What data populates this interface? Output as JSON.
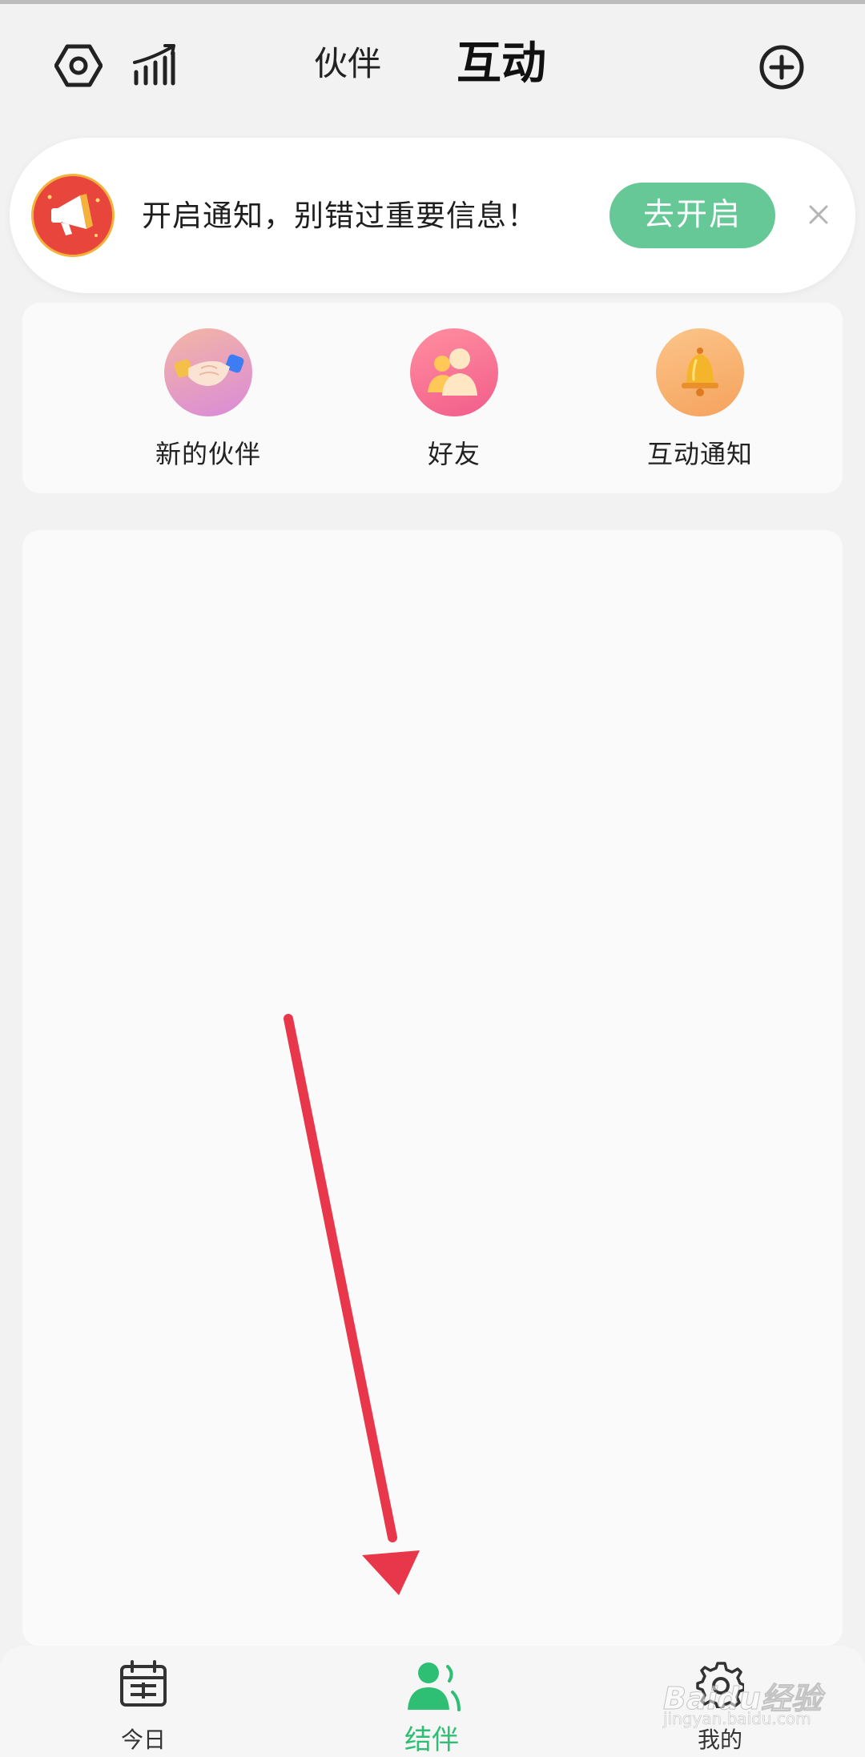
{
  "header": {
    "tabs": [
      {
        "label": "伙伴",
        "active": false
      },
      {
        "label": "互动",
        "active": true
      }
    ],
    "icons": [
      "hexagon-settings-icon",
      "stats-icon",
      "add-circle-icon"
    ]
  },
  "notice": {
    "text": "开启通知，别错过重要信息！",
    "button_label": "去开启",
    "icon": "megaphone-icon",
    "close_icon": "close-icon"
  },
  "quick_actions": [
    {
      "label": "新的伙伴",
      "icon": "handshake-icon"
    },
    {
      "label": "好友",
      "icon": "friends-icon"
    },
    {
      "label": "互动通知",
      "icon": "bell-icon"
    }
  ],
  "bottom_nav": {
    "items": [
      {
        "label": "今日",
        "icon": "calendar-icon",
        "active": false
      },
      {
        "label": "结伴",
        "icon": "partner-icon",
        "active": true
      },
      {
        "label": "我的",
        "icon": "gear-icon",
        "active": false
      }
    ]
  },
  "watermark": {
    "text": "Baidu经验",
    "sub": "jingyan.baidu.com"
  },
  "colors": {
    "accent_green": "#2fbf74",
    "button_green": "#66c896",
    "annotation_red": "#e8374a"
  }
}
